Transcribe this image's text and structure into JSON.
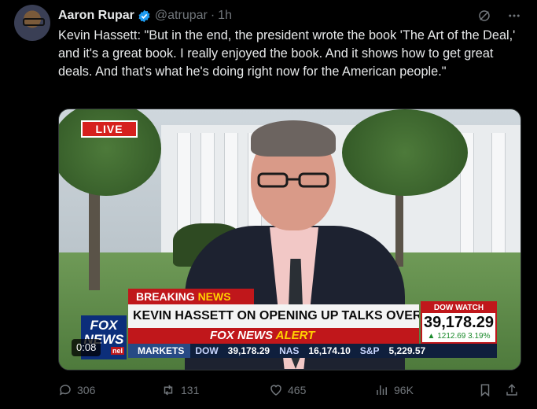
{
  "author": {
    "name": "Aaron Rupar",
    "handle": "@atrupar",
    "separator": "·",
    "time": "1h",
    "verified": true,
    "avatar_icon": "avatar"
  },
  "tweet": {
    "text": "Kevin Hassett: \"But in the end, the president wrote the book 'The Art of the Deal,' and it's a great book. I really enjoyed the book. And it shows how to get great deals. And that's what he's doing right now for the American people.\""
  },
  "video": {
    "live_badge": "LIVE",
    "breaking_label": "BREAKING",
    "breaking_label_news": "NEWS",
    "headline": "KEVIN HASSETT ON OPENING UP TALKS OVER TARIFFS",
    "alert_prefix": "FOX NEWS",
    "alert_word": "ALERT",
    "network_logo_top": "FOX",
    "network_logo_bottom": "NEWS",
    "network_logo_tag": "nel",
    "dow_watch_title": "DOW WATCH",
    "dow_value": "39,178.29",
    "dow_change": "▲ 1212.69 3.19%",
    "ticker": {
      "label": "MARKETS",
      "items": [
        {
          "sym": "DOW",
          "val": "39,178.29"
        },
        {
          "sym": "NAS",
          "val": "16,174.10"
        },
        {
          "sym": "S&P",
          "val": "5,229.57"
        }
      ]
    },
    "timer": "0:08"
  },
  "actions": {
    "replies": "306",
    "retweets": "131",
    "likes": "465",
    "views": "96K"
  },
  "colors": {
    "background": "#000000",
    "text": "#e7e9ea",
    "muted": "#71767b",
    "verified": "#1d9bf0",
    "fox_red": "#c0171b"
  }
}
